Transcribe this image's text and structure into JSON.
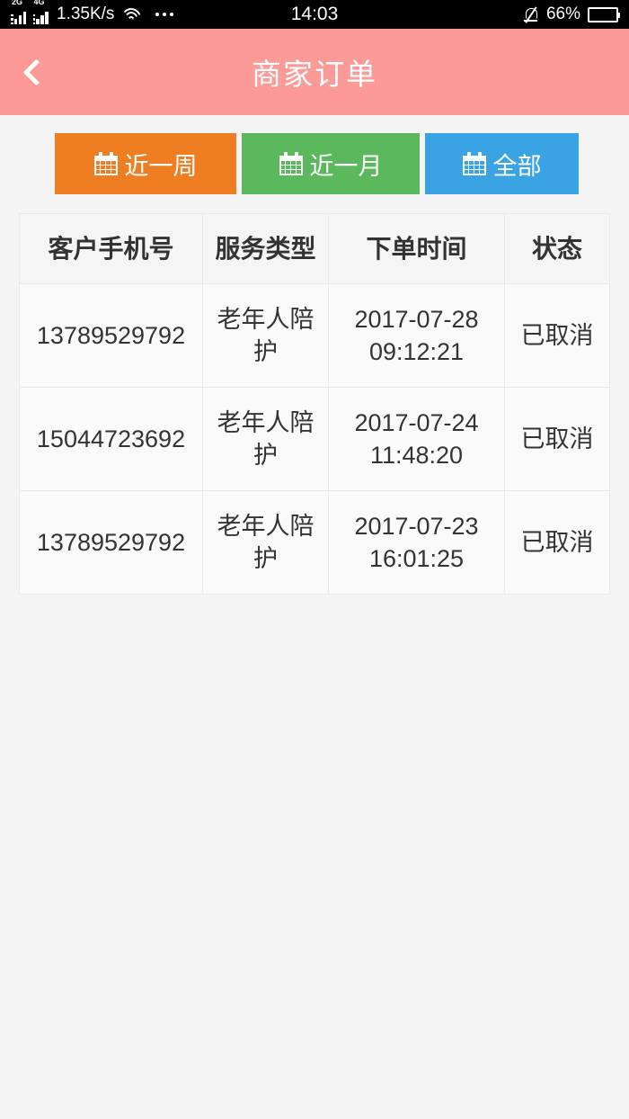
{
  "status_bar": {
    "network_1_label": "2G",
    "network_2_label": "4G",
    "net_speed": "1.35K/s",
    "wifi_icon": "wifi-icon",
    "more_icon": "more-dots-icon",
    "time": "14:03",
    "silent_icon": "bell-muted-icon",
    "battery_percent": "66%",
    "battery_level": 66
  },
  "header": {
    "back_icon": "chevron-left-icon",
    "title": "商家订单",
    "background_color": "#fb9a96"
  },
  "filters": [
    {
      "label": "近一周",
      "icon": "calendar-icon",
      "color": "#ef7d22",
      "name": "filter-last-week"
    },
    {
      "label": "近一月",
      "icon": "calendar-icon",
      "color": "#5cb85c",
      "name": "filter-last-month"
    },
    {
      "label": "全部",
      "icon": "calendar-icon",
      "color": "#3aa3e3",
      "name": "filter-all"
    }
  ],
  "orders_table": {
    "columns": [
      "客户手机号",
      "服务类型",
      "下单时间",
      "状态"
    ],
    "rows": [
      {
        "phone": "13789529792",
        "service_type": "老年人陪护",
        "order_time": "2017-07-28 09:12:21",
        "status": "已取消"
      },
      {
        "phone": "15044723692",
        "service_type": "老年人陪护",
        "order_time": "2017-07-24 11:48:20",
        "status": "已取消"
      },
      {
        "phone": "13789529792",
        "service_type": "老年人陪护",
        "order_time": "2017-07-23 16:01:25",
        "status": "已取消"
      }
    ]
  }
}
